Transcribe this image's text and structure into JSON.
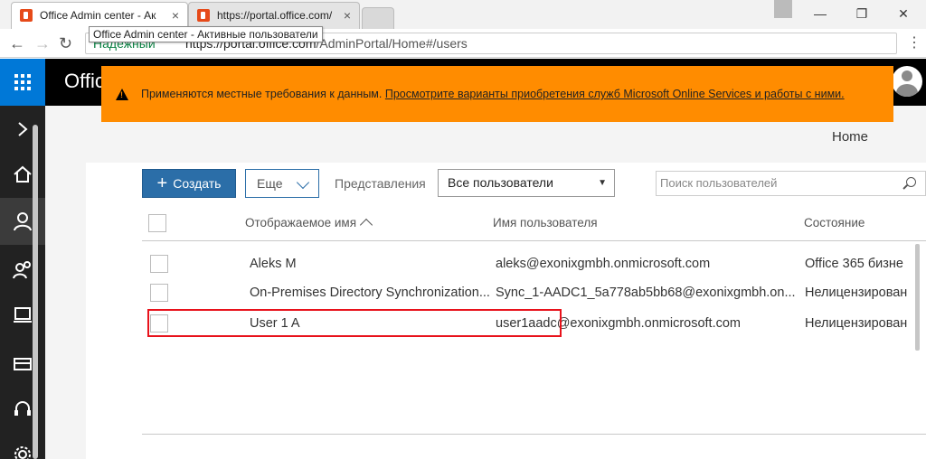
{
  "browser": {
    "tabs": [
      {
        "title": "Office Admin center - Ак",
        "active": true
      },
      {
        "title": "https://portal.office.com/",
        "active": false
      }
    ],
    "tab_close_glyph": "×",
    "tooltip": "Office Admin center - Активные пользователи",
    "address": {
      "secure_label": "Надежный",
      "url_host": "https://portal.office.com",
      "url_path": "/AdminPortal/Home#/users"
    },
    "window_controls": {
      "minimize": "—",
      "maximize": "❐",
      "close": "✕"
    }
  },
  "appbar": {
    "title": "Office"
  },
  "banner": {
    "text": "Применяются местные требования к данным.",
    "link": "Просмотрите варианты приобретения служб Microsoft Online Services и работы с ними.",
    "color": "#ff8c00"
  },
  "sidebar": {
    "items": [
      {
        "icon": "chevron-right-icon",
        "glyph": "›"
      },
      {
        "icon": "home-icon"
      },
      {
        "icon": "user-icon",
        "active": true
      },
      {
        "icon": "groups-icon"
      },
      {
        "icon": "devices-icon"
      },
      {
        "icon": "billing-icon"
      },
      {
        "icon": "support-icon"
      },
      {
        "icon": "settings-icon"
      }
    ]
  },
  "breadcrumb": {
    "home": "Home"
  },
  "toolbar": {
    "create_label": "Создать",
    "create_glyph": "+",
    "more_label": "Еще",
    "views_label": "Представления",
    "views_selected": "Все пользователи",
    "views_arrow": "▼",
    "search_placeholder": "Поиск пользователей"
  },
  "table": {
    "columns": [
      "Отображаемое имя",
      "Имя пользователя",
      "Состояние"
    ],
    "rows": [
      {
        "display_name": "Aleks M",
        "username": "aleks@exonixgmbh.onmicrosoft.com",
        "status": "Office 365 бизне"
      },
      {
        "display_name": "On-Premises Directory Synchronization...",
        "username": "Sync_1-AADC1_5a778ab5bb68@exonixgmbh.on...",
        "status": "Нелицензирован"
      },
      {
        "display_name": "User 1 A",
        "username": "user1aadc@exonixgmbh.onmicrosoft.com",
        "status": "Нелицензирован",
        "highlighted": true
      }
    ]
  },
  "colors": {
    "accent": "#2b6ea8",
    "brand": "#0078d7",
    "highlight_border": "#e8121b"
  }
}
